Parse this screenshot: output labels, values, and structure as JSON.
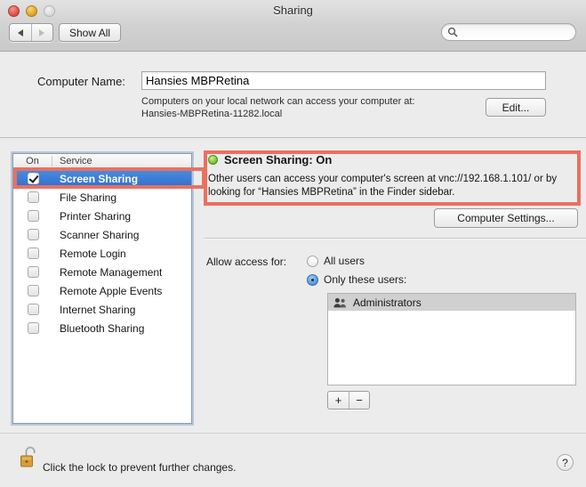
{
  "window": {
    "title": "Sharing",
    "traffic_lights": [
      {
        "name": "close",
        "color": "#e1564a"
      },
      {
        "name": "minimize",
        "color": "#e4a929"
      },
      {
        "name": "zoom",
        "color": "#dcdcdc",
        "state": "disabled"
      }
    ]
  },
  "toolbar": {
    "back_icon": "triangle-left-icon",
    "forward_icon": "triangle-right-icon",
    "back_enabled": true,
    "forward_enabled": false,
    "show_all_label": "Show All",
    "search": {
      "icon": "search-icon",
      "value": "",
      "placeholder": ""
    }
  },
  "computer_name": {
    "label": "Computer Name:",
    "value": "Hansies MBPRetina",
    "placeholder": "",
    "help_line1": "Computers on your local network can access your computer at:",
    "help_line2": "Hansies-MBPRetina-11282.local",
    "edit_label": "Edit..."
  },
  "service_list": {
    "columns": [
      "On",
      "Service"
    ],
    "rows": [
      {
        "name": "Screen Sharing",
        "on": true,
        "selected": true
      },
      {
        "name": "File Sharing",
        "on": false,
        "selected": false
      },
      {
        "name": "Printer Sharing",
        "on": false,
        "selected": false
      },
      {
        "name": "Scanner Sharing",
        "on": false,
        "selected": false
      },
      {
        "name": "Remote Login",
        "on": false,
        "selected": false
      },
      {
        "name": "Remote Management",
        "on": false,
        "selected": false
      },
      {
        "name": "Remote Apple Events",
        "on": false,
        "selected": false
      },
      {
        "name": "Internet Sharing",
        "on": false,
        "selected": false
      },
      {
        "name": "Bluetooth Sharing",
        "on": false,
        "selected": false
      }
    ]
  },
  "detail": {
    "status_icon": "green-status-dot-icon",
    "status_color": "#84cc3f",
    "status_text": "Screen Sharing: On",
    "description": "Other users can access your computer's screen at vnc://192.168.1.101/ or by looking for “Hansies MBPRetina” in the Finder sidebar.",
    "vnc_address": "vnc://192.168.1.101/",
    "computer_settings_label": "Computer Settings...",
    "access_label": "Allow access for:",
    "access_options": [
      {
        "label": "All users",
        "selected": false
      },
      {
        "label": "Only these users:",
        "selected": true
      }
    ],
    "users": [
      {
        "label": "Administrators",
        "icon": "group-of-users-icon",
        "selected": true
      }
    ],
    "add_label": "+",
    "remove_label": "−"
  },
  "bottom": {
    "lock_icon": "open-padlock-icon",
    "lock_state": "unlocked",
    "lock_text": "Click the lock to prevent further changes.",
    "help_label": "?"
  },
  "annotations": {
    "color": "#ea7060",
    "boxes": [
      {
        "name": "screen-sharing-row-highlight"
      },
      {
        "name": "screen-sharing-status-highlight"
      }
    ]
  }
}
